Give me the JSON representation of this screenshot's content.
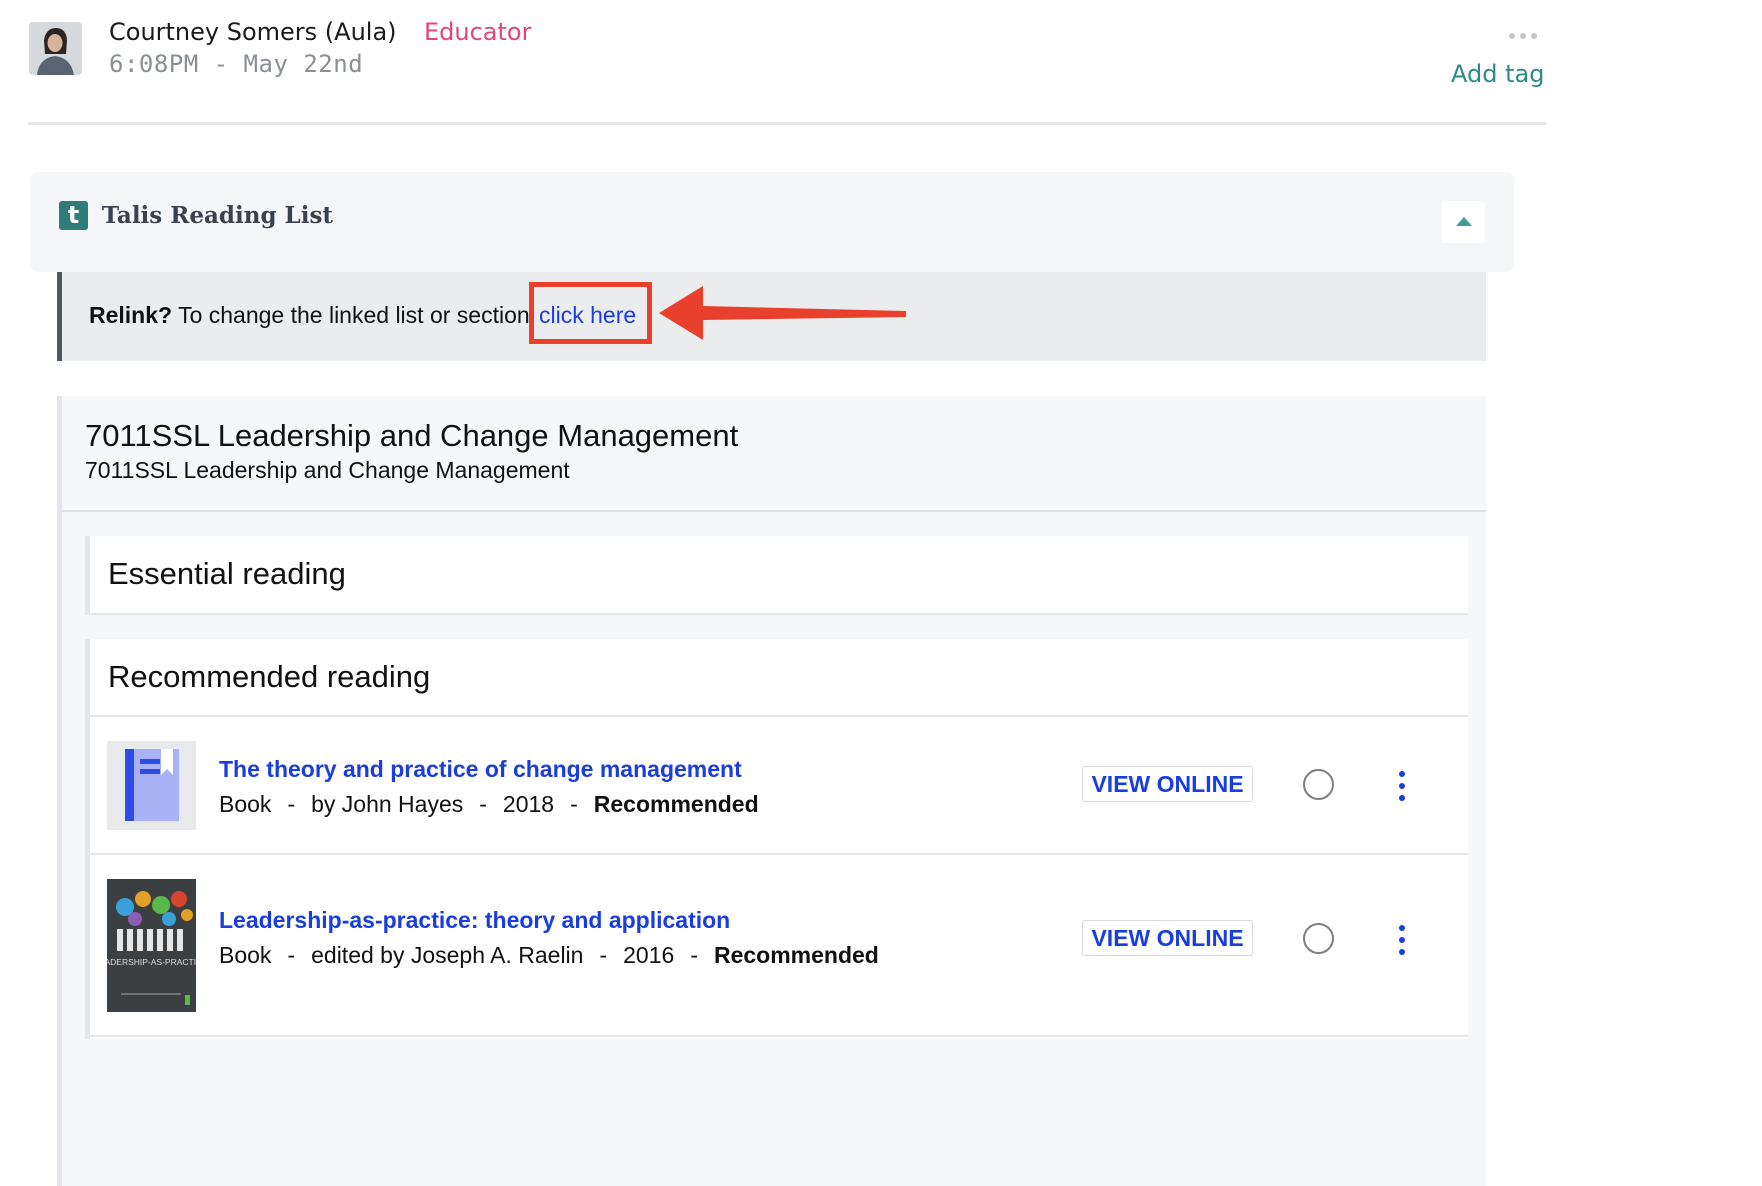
{
  "post": {
    "author": "Courtney Somers (Aula)",
    "role": "Educator",
    "timestamp": "6:08PM - May 22nd",
    "add_tag_label": "Add tag",
    "more_icon": "more-horizontal-icon",
    "role_color": "#e0457b",
    "link_color": "#2e8a86"
  },
  "talis": {
    "logo_letter": "t",
    "title": "Talis Reading List",
    "collapse_icon": "chevron-up-icon",
    "brand_color": "#2e7d7a"
  },
  "relink": {
    "bold_label": "Relink?",
    "text": "To change the linked list or section",
    "link_label": "click here",
    "annotation": "red-highlight-box-and-arrow"
  },
  "reading_list": {
    "title": "7011SSL Leadership and Change Management",
    "subtitle": "7011SSL Leadership and Change Management",
    "sections": [
      {
        "heading": "Essential reading",
        "items": []
      },
      {
        "heading": "Recommended reading",
        "items": [
          {
            "title": "The theory and practice of change management",
            "type": "Book",
            "author": "by John Hayes",
            "year": "2018",
            "importance": "Recommended",
            "action_label": "VIEW ONLINE",
            "cover": "generic-book-icon"
          },
          {
            "title": "Leadership-as-practice: theory and application",
            "type": "Book",
            "author": "edited by Joseph A. Raelin",
            "year": "2016",
            "importance": "Recommended",
            "action_label": "VIEW ONLINE",
            "cover": "book-cover-image",
            "cover_text": "LEADERSHIP-AS-PRACTICE"
          }
        ]
      }
    ],
    "link_color": "#1a3de0"
  }
}
